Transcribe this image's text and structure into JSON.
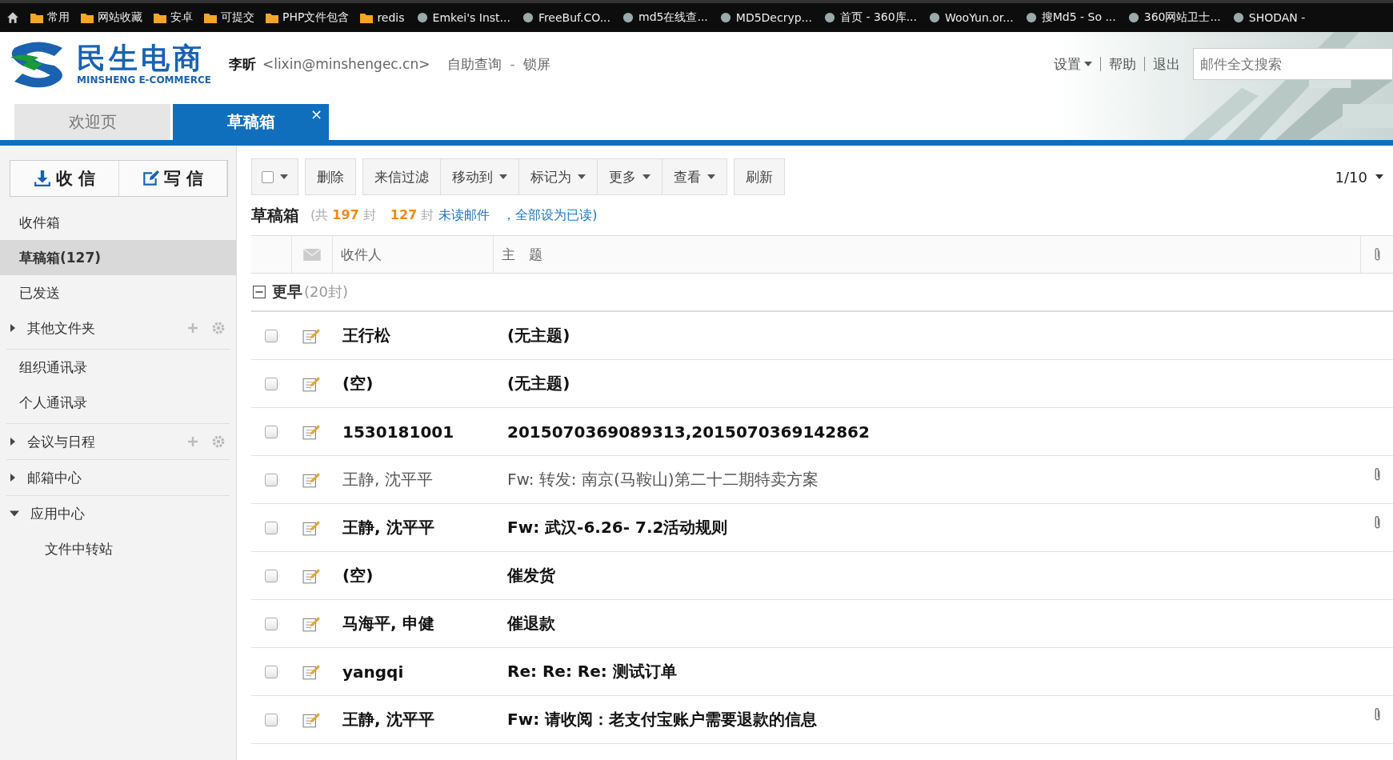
{
  "bookmarks": [
    {
      "label": "常用",
      "kind": "folder"
    },
    {
      "label": "网站收藏",
      "kind": "folder"
    },
    {
      "label": "安卓",
      "kind": "folder"
    },
    {
      "label": "可提交",
      "kind": "folder"
    },
    {
      "label": "PHP文件包含",
      "kind": "folder"
    },
    {
      "label": "redis",
      "kind": "folder"
    },
    {
      "label": "Emkei's Inst...",
      "kind": "site"
    },
    {
      "label": "FreeBuf.CO...",
      "kind": "site"
    },
    {
      "label": "md5在线查...",
      "kind": "site"
    },
    {
      "label": "MD5Decryp...",
      "kind": "site"
    },
    {
      "label": "首页 - 360库...",
      "kind": "site"
    },
    {
      "label": "WooYun.or...",
      "kind": "site"
    },
    {
      "label": "搜Md5 - So ...",
      "kind": "site"
    },
    {
      "label": "360网站卫士...",
      "kind": "site"
    },
    {
      "label": "SHODAN -",
      "kind": "site"
    }
  ],
  "logo": {
    "name": "民生电商",
    "subtitle": "MINSHENG E-COMMERCE"
  },
  "user": {
    "name": "李昕",
    "email": "<lixin@minshengec.cn>",
    "links": [
      "自助查询",
      "锁屏"
    ],
    "separator": "-"
  },
  "top_links": [
    "设置",
    "帮助",
    "退出"
  ],
  "search": {
    "placeholder": "邮件全文搜索"
  },
  "tabs": [
    {
      "label": "欢迎页",
      "selected": false
    },
    {
      "label": "草稿箱",
      "selected": true,
      "close": "×"
    }
  ],
  "compose": {
    "receive": "收 信",
    "write": "写 信"
  },
  "sidebar": {
    "sections": [
      [
        {
          "label": "收件箱",
          "selected": false
        },
        {
          "label": "草稿箱(127)",
          "selected": true
        },
        {
          "label": "已发送",
          "selected": false
        },
        {
          "label": "其他文件夹",
          "selected": false,
          "expanded": false,
          "tools": true
        }
      ],
      [
        {
          "label": "组织通讯录",
          "selected": false
        },
        {
          "label": "个人通讯录",
          "selected": false
        }
      ],
      [
        {
          "label": "会议与日程",
          "selected": false,
          "expanded": false,
          "tools": true
        }
      ],
      [
        {
          "label": "邮箱中心",
          "selected": false,
          "expanded": false
        }
      ],
      [
        {
          "label": "应用中心",
          "selected": false,
          "expanded": true,
          "children": [
            {
              "label": "文件中转站",
              "selected": false
            }
          ]
        }
      ]
    ]
  },
  "toolbar": [
    {
      "label": "删除",
      "dropdown": false
    },
    {
      "label": "来信过滤",
      "dropdown": false
    },
    {
      "label": "移动到",
      "dropdown": true
    },
    {
      "label": "标记为",
      "dropdown": true
    },
    {
      "label": "更多",
      "dropdown": true
    },
    {
      "label": "查看",
      "dropdown": true
    },
    {
      "label": "刷新",
      "dropdown": false
    }
  ],
  "pager": "1/10",
  "folder": {
    "title": "草稿箱",
    "total_prefix": "(共",
    "total": "197",
    "total_unit": "封",
    "unread": "127",
    "unread_unit": "封",
    "unread_label": "未读邮件",
    "mark_all": "，全部设为已读)"
  },
  "columns": [
    "收件人",
    "主　题"
  ],
  "group": {
    "label": "更早",
    "count": "(20封)",
    "expanded": true
  },
  "emails": [
    {
      "to": "王行松",
      "subject": "(无主题)",
      "unread": true,
      "attachment": false,
      "checked": false
    },
    {
      "to": "(空)",
      "subject": "(无主题)",
      "unread": true,
      "attachment": false,
      "checked": false
    },
    {
      "to": "1530181001",
      "subject": "2015070369089313,2015070369142862",
      "unread": true,
      "attachment": false,
      "checked": false
    },
    {
      "to": "王静, 沈平平",
      "subject": "Fw: 转发: 南京(马鞍山)第二十二期特卖方案",
      "unread": false,
      "attachment": true,
      "checked": false
    },
    {
      "to": "王静, 沈平平",
      "subject": "Fw: 武汉-6.26- 7.2活动规则",
      "unread": true,
      "attachment": true,
      "checked": false
    },
    {
      "to": "(空)",
      "subject": "催发货",
      "unread": true,
      "attachment": false,
      "checked": false
    },
    {
      "to": "马海平, 申健",
      "subject": "催退款",
      "unread": true,
      "attachment": false,
      "checked": false
    },
    {
      "to": "yangqi",
      "subject": "Re: Re: Re: 测试订单",
      "unread": true,
      "attachment": false,
      "checked": false
    },
    {
      "to": "王静, 沈平平",
      "subject": "Fw: 请收阅：老支付宝账户需要退款的信息",
      "unread": true,
      "attachment": true,
      "checked": false
    }
  ]
}
